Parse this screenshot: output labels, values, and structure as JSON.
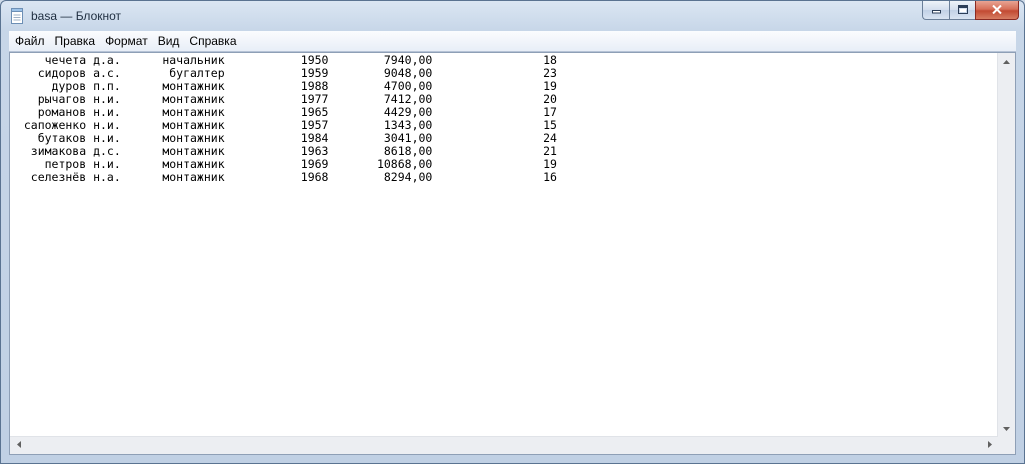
{
  "window": {
    "title": "basa — Блокнот"
  },
  "menu": [
    {
      "label": "Файл"
    },
    {
      "label": "Правка"
    },
    {
      "label": "Формат"
    },
    {
      "label": "Вид"
    },
    {
      "label": "Справка"
    }
  ],
  "editor": {
    "lines": [
      "     чечета д.а.      начальник           1950        7940,00                18",
      "    сидоров а.с.       бугалтер           1959        9048,00                23",
      "      дуров п.п.      монтажник           1988        4700,00                19",
      "    рычагов н.и.      монтажник           1977        7412,00                20",
      "    романов н.и.      монтажник           1965        4429,00                17",
      "  сапоженко н.и.      монтажник           1957        1343,00                15",
      "    бутаков н.и.      монтажник           1984        3041,00                24",
      "   зимакова д.с.      монтажник           1963        8618,00                21",
      "     петров н.и.      монтажник           1969       10868,00                19",
      "   селезнёв н.а.      монтажник           1968        8294,00                16"
    ]
  },
  "icons": {
    "app": "notepad-icon",
    "minimize": "minimize-icon",
    "maximize": "maximize-icon",
    "close": "close-icon",
    "scroll_up": "arrow-up-icon",
    "scroll_down": "arrow-down-icon",
    "scroll_left": "arrow-left-icon",
    "scroll_right": "arrow-right-icon"
  },
  "colors": {
    "frame": "#c7d6e8",
    "close_button": "#c24a33",
    "editor_bg": "#ffffff"
  }
}
